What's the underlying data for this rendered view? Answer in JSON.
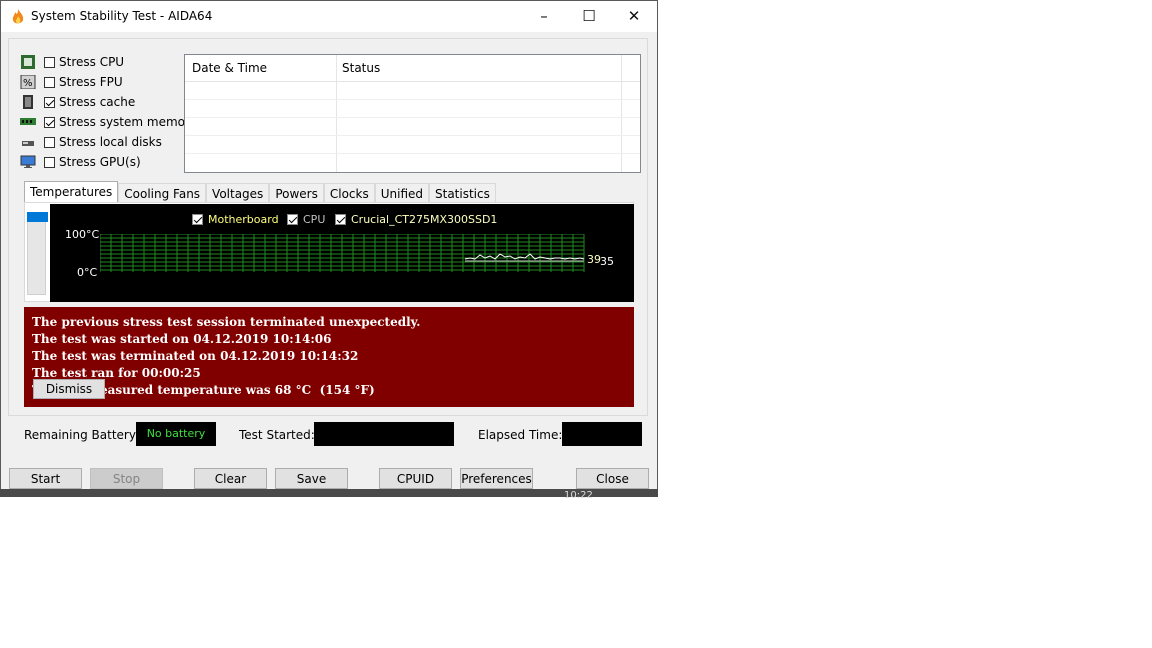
{
  "window": {
    "title": "System Stability Test - AIDA64",
    "minimize": "–",
    "maximize": "☐",
    "close": "✕"
  },
  "stress_options": [
    {
      "label": "Stress CPU",
      "checked": false,
      "icon": "cpu-chip-icon"
    },
    {
      "label": "Stress FPU",
      "checked": false,
      "icon": "fpu-percent-icon"
    },
    {
      "label": "Stress cache",
      "checked": true,
      "icon": "cache-chip-icon"
    },
    {
      "label": "Stress system memory",
      "checked": true,
      "icon": "memory-module-icon"
    },
    {
      "label": "Stress local disks",
      "checked": false,
      "icon": "disk-drive-icon"
    },
    {
      "label": "Stress GPU(s)",
      "checked": false,
      "icon": "gpu-monitor-icon"
    }
  ],
  "log": {
    "col_datetime": "Date & Time",
    "col_status": "Status"
  },
  "tabs": [
    "Temperatures",
    "Cooling Fans",
    "Voltages",
    "Powers",
    "Clocks",
    "Unified",
    "Statistics"
  ],
  "graph": {
    "legend": [
      {
        "label": "Motherboard",
        "color": "#ffff80"
      },
      {
        "label": "CPU",
        "color": "#c0c0c0"
      },
      {
        "label": "Crucial_CT275MX300SSD1",
        "color": "#ffffc0"
      }
    ],
    "y_top": "100°C",
    "y_bottom": "0°C",
    "value_a": "39",
    "value_b": "35"
  },
  "alert": {
    "line1": "The previous stress test session terminated unexpectedly.",
    "line2": "The test was started on 04.12.2019 10:14:06",
    "line3": "The test was terminated on 04.12.2019 10:14:32",
    "line4": "The test ran for 00:00:25",
    "line5": "T        n measured temperature was 68 °C  (154 °F)",
    "dismiss": "Dismiss"
  },
  "status": {
    "battery_label": "Remaining Battery:",
    "battery_value": "No battery",
    "started_label": "Test Started:",
    "elapsed_label": "Elapsed Time:"
  },
  "buttons": {
    "start": "Start",
    "stop": "Stop",
    "clear": "Clear",
    "save": "Save",
    "cpuid": "CPUID",
    "preferences": "Preferences",
    "close": "Close"
  },
  "taskbar": {
    "time": "10:22"
  }
}
